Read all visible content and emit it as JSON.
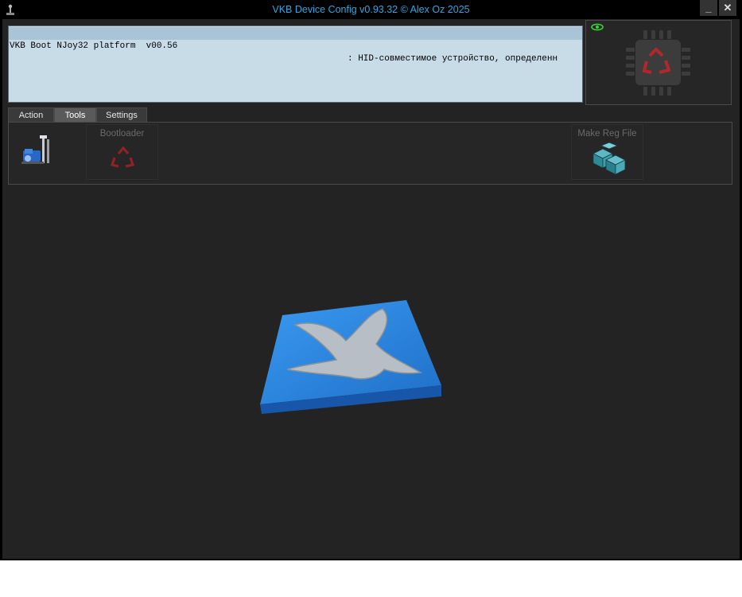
{
  "window": {
    "title": "VKB Device Config v0.93.32  © Alex Oz 2025",
    "minimize_label": "_",
    "close_label": "✕"
  },
  "console": {
    "device_line_left": "VKB Boot NJoy32 platform  v00.56",
    "device_line_right": ": HID-совместимое устройство, определенн"
  },
  "tabs": [
    {
      "label": "Action",
      "active": false
    },
    {
      "label": "Tools",
      "active": true
    },
    {
      "label": "Settings",
      "active": false
    }
  ],
  "tools": {
    "bootloader_label": "Bootloader",
    "make_reg_label": "Make Reg File"
  },
  "icons": {
    "app": "joystick-icon",
    "tools": "tools-icon",
    "bootloader": "recycle-icon",
    "make_reg": "registry-cubes-icon",
    "chip": "chip-icon",
    "status": "eye-icon",
    "logo": "vkb-eagle-logo"
  },
  "colors": {
    "title_text": "#2aa8e6",
    "console_bg": "#c8dce8",
    "console_highlight": "#a9c4d6",
    "recycle_red": "#b0282d",
    "status_green": "#3ad13a",
    "logo_blue": "#2b7fd8"
  }
}
